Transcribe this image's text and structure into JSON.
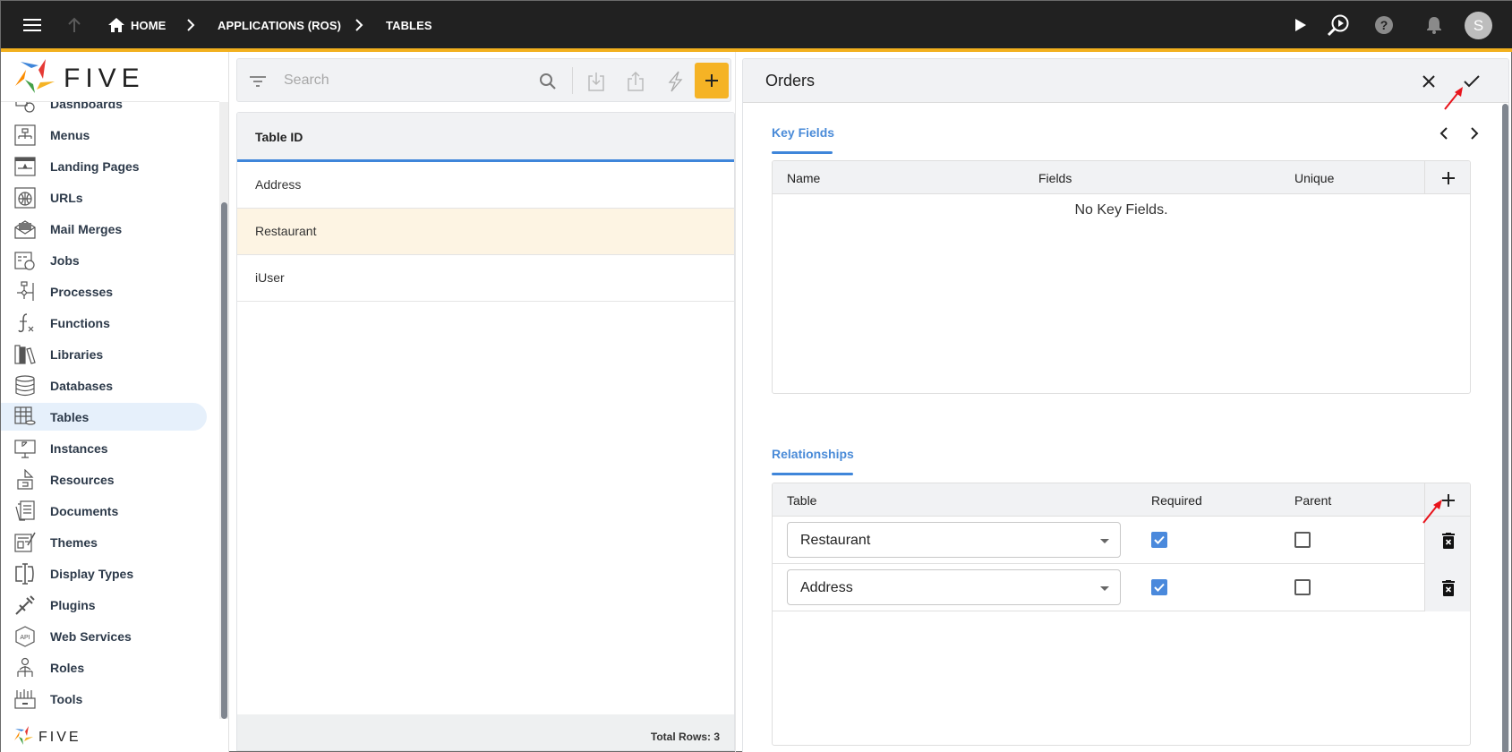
{
  "topbar": {
    "menu_icon": "hamburger-icon",
    "up_icon": "arrow-up-icon",
    "breadcrumbs": [
      {
        "label": "HOME",
        "icon": "home-icon"
      },
      {
        "label": "APPLICATIONS (ROS)"
      },
      {
        "label": "TABLES"
      }
    ],
    "actions": [
      "play-icon",
      "search-play-icon",
      "help-icon",
      "bell-icon"
    ],
    "avatar_initial": "S"
  },
  "sidebar": {
    "logo_text": "FIVE",
    "items": [
      {
        "label": "Dashboards",
        "icon": "dashboard-icon"
      },
      {
        "label": "Menus",
        "icon": "menus-icon"
      },
      {
        "label": "Landing Pages",
        "icon": "landing-page-icon"
      },
      {
        "label": "URLs",
        "icon": "globe-icon"
      },
      {
        "label": "Mail Merges",
        "icon": "mail-merge-icon"
      },
      {
        "label": "Jobs",
        "icon": "jobs-icon"
      },
      {
        "label": "Processes",
        "icon": "processes-icon"
      },
      {
        "label": "Functions",
        "icon": "function-icon"
      },
      {
        "label": "Libraries",
        "icon": "libraries-icon"
      },
      {
        "label": "Databases",
        "icon": "database-icon"
      },
      {
        "label": "Tables",
        "icon": "tables-icon",
        "active": true
      },
      {
        "label": "Instances",
        "icon": "instances-icon"
      },
      {
        "label": "Resources",
        "icon": "resources-icon"
      },
      {
        "label": "Documents",
        "icon": "documents-icon"
      },
      {
        "label": "Themes",
        "icon": "themes-icon"
      },
      {
        "label": "Display Types",
        "icon": "display-types-icon"
      },
      {
        "label": "Plugins",
        "icon": "plugins-icon"
      },
      {
        "label": "Web Services",
        "icon": "api-icon"
      },
      {
        "label": "Roles",
        "icon": "roles-icon"
      },
      {
        "label": "Tools",
        "icon": "tools-icon"
      }
    ]
  },
  "list": {
    "search_placeholder": "Search",
    "search_value": "",
    "column_header": "Table ID",
    "rows": [
      "Address",
      "Restaurant",
      "iUser"
    ],
    "selected_row": "Restaurant",
    "footer": "Total Rows: 3"
  },
  "form": {
    "title": "Orders",
    "key_fields": {
      "tab_label": "Key Fields",
      "columns": [
        "Name",
        "Fields",
        "Unique"
      ],
      "empty_message": "No Key Fields."
    },
    "relationships": {
      "tab_label": "Relationships",
      "columns": [
        "Table",
        "Required",
        "Parent"
      ],
      "rows": [
        {
          "table": "Restaurant",
          "required": true,
          "parent": false
        },
        {
          "table": "Address",
          "required": true,
          "parent": false
        }
      ]
    }
  },
  "colors": {
    "topbar": "#212121",
    "accent": "#f2b01e",
    "primary_blue": "#3f86da",
    "selected_row": "#fdf4e3",
    "add_button": "#f5b325"
  }
}
